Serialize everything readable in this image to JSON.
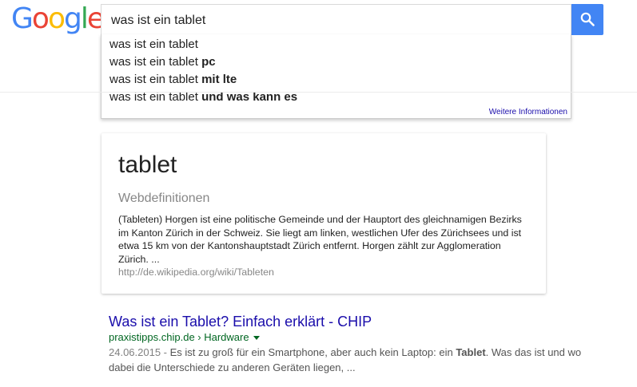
{
  "logo": {
    "letters": [
      "G",
      "o",
      "o",
      "g",
      "l",
      "e"
    ],
    "colors": [
      "#4285f4",
      "#ea4335",
      "#fbbc05",
      "#4285f4",
      "#34a853",
      "#ea4335"
    ]
  },
  "search": {
    "value": "was ist ein tablet",
    "button_icon": "search-icon"
  },
  "suggestions": [
    {
      "base": "was ist ein tablet",
      "bold": ""
    },
    {
      "base": "was ist ein tablet ",
      "bold": "pc"
    },
    {
      "base": "was ist ein tablet ",
      "bold": "mit lte"
    },
    {
      "base": "was ist ein tablet ",
      "bold": "und was kann es"
    }
  ],
  "suggest_more": "Weitere Informationen",
  "knowledge_panel": {
    "title": "tablet",
    "subtitle": "Webdefinitionen",
    "description": "(Tableten) Horgen ist eine politische Gemeinde und der Hauptort des gleichnamigen Bezirks im Kanton Zürich in der Schweiz. Sie liegt am linken, westlichen Ufer des Zürichsees und ist etwa 15 km von der Kantonshauptstadt Zürich entfernt. Horgen zählt zur Agglomeration Zürich. ...",
    "source": "http://de.wikipedia.org/wiki/Tableten"
  },
  "result": {
    "title": "Was ist ein Tablet? Einfach erklärt - CHIP",
    "url": "praxistipps.chip.de › Hardware",
    "date": "24.06.2015 - ",
    "snippet_pre": "Es ist zu groß für ein Smartphone, aber auch kein Laptop: ein ",
    "snippet_bold": "Tablet",
    "snippet_post": ". Was das ist und wo dabei die Unterschiede zu anderen Geräten liegen, ..."
  },
  "colors": {
    "accent": "#4285f4",
    "link": "#1a0dab",
    "url": "#006621"
  }
}
